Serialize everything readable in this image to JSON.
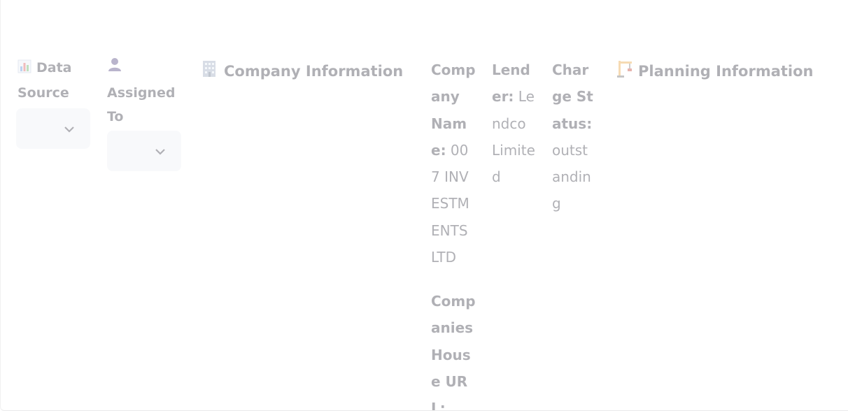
{
  "filters": {
    "data_source": {
      "icon": "bar-chart-icon",
      "label": "Data Source",
      "value": ""
    },
    "assigned_to": {
      "icon": "person-icon",
      "label": "Assigned To",
      "value": ""
    }
  },
  "sections": {
    "company_information": {
      "icon": "office-building-icon",
      "title": "Company Information"
    },
    "planning_information": {
      "icon": "construction-crane-icon",
      "title": "Planning Information"
    }
  },
  "fields": {
    "company_name": {
      "label": "Company Name:",
      "value": "007 INVESTMENTS LTD"
    },
    "lender": {
      "label": "Lender:",
      "value": "Lendco Limited"
    },
    "charge_status": {
      "label": "Charge Status:",
      "value": "outstanding"
    },
    "companies_house_url": {
      "label": "Companies House URL:"
    }
  },
  "colors": {
    "text": "#31333f",
    "select_bg": "#eef1f7"
  }
}
